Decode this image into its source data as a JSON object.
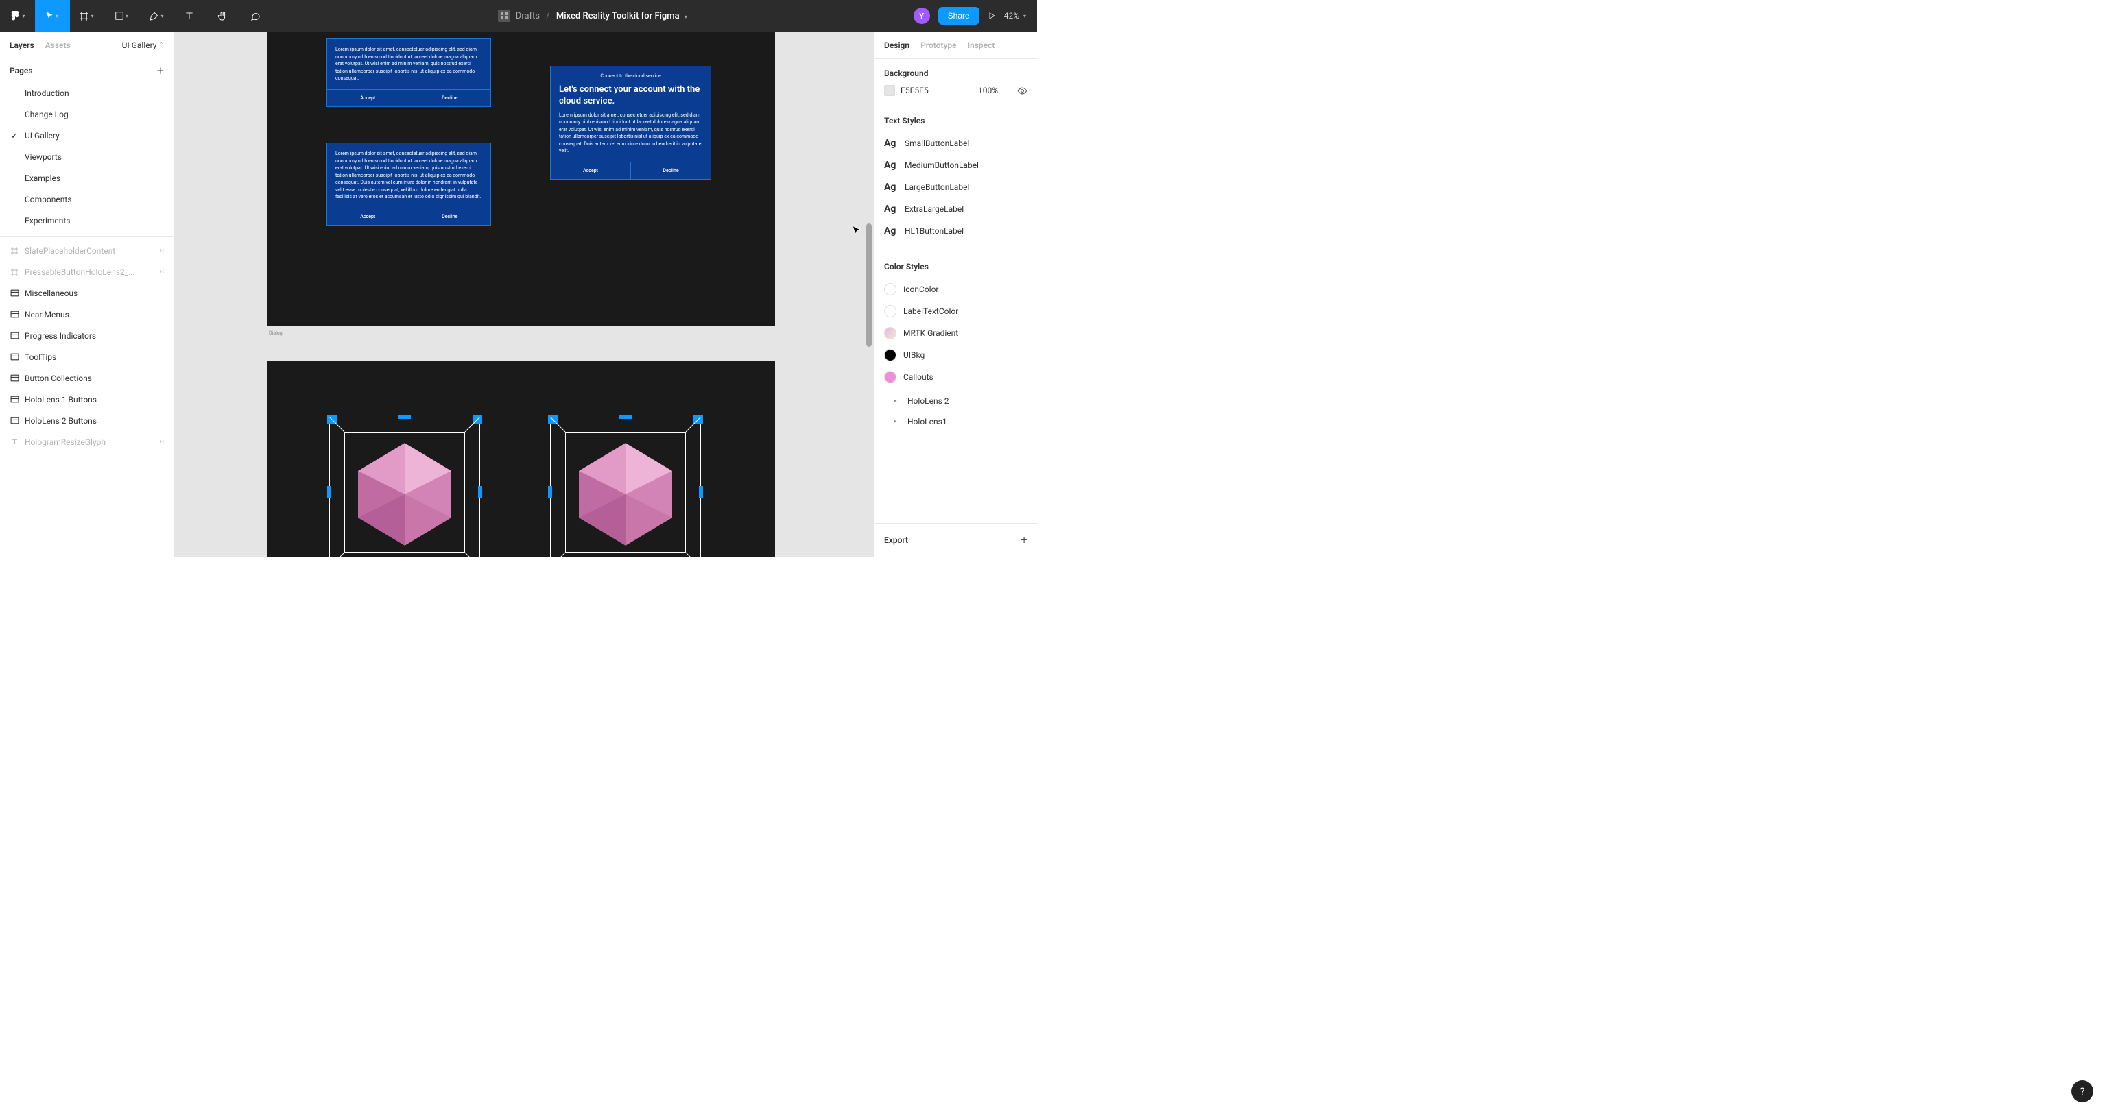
{
  "toolbar": {
    "project_folder": "Drafts",
    "document_title": "Mixed Reality Toolkit for Figma",
    "avatar_initial": "Y",
    "share_label": "Share",
    "zoom": "42%"
  },
  "left_panel": {
    "tabs": {
      "layers": "Layers",
      "assets": "Assets"
    },
    "page_selector": "UI Gallery",
    "pages_header": "Pages",
    "pages": [
      {
        "label": "Introduction",
        "selected": false
      },
      {
        "label": "Change Log",
        "selected": false
      },
      {
        "label": "UI Gallery",
        "selected": true
      },
      {
        "label": "Viewports",
        "selected": false
      },
      {
        "label": "Examples",
        "selected": false
      },
      {
        "label": "Components",
        "selected": false
      },
      {
        "label": "Experiments",
        "selected": false
      }
    ],
    "layers": [
      {
        "icon": "frame",
        "label": "SlatePlaceholderContent",
        "dim": true,
        "glyph": true
      },
      {
        "icon": "frame",
        "label": "PressableButtonHoloLens2_...",
        "dim": true,
        "glyph": true
      },
      {
        "icon": "section",
        "label": "Miscellaneous",
        "dim": false
      },
      {
        "icon": "section",
        "label": "Near Menus",
        "dim": false
      },
      {
        "icon": "section",
        "label": "Progress Indicators",
        "dim": false
      },
      {
        "icon": "section",
        "label": "ToolTips",
        "dim": false
      },
      {
        "icon": "section",
        "label": "Button Collections",
        "dim": false
      },
      {
        "icon": "section",
        "label": "HoloLens 1 Buttons",
        "dim": false
      },
      {
        "icon": "section",
        "label": "HoloLens 2 Buttons",
        "dim": false
      },
      {
        "icon": "text",
        "label": "HologramResizeGlyph",
        "dim": true,
        "glyph": true
      }
    ]
  },
  "canvas": {
    "frame1_label": "Dialog",
    "dialog_text_short": "Lorem ipsum dolor sit amet, consectetuer adipiscing elit, sed diam nonummy nibh euismod tincidunt ut laoreet dolore magna aliquam erat volutpat. Ut wisi enim ad minim veniam, quis nostrud exerci tation ullamcorper suscipit lobortis nisl ut aliquip ex ea commodo consequat.",
    "dialog_text_long": "Lorem ipsum dolor sit amet, consectetuer adipiscing elit, sed diam nonummy nibh euismod tincidunt ut laoreet dolore magna aliquam erat volutpat. Ut wisi enim ad minim veniam, quis nostrud exerci tation ullamcorper suscipit lobortis nisl ut aliquip ex ea commodo consequat. Duis autem vel eum iriure dolor in hendrerit in vulputate velit esse molestie consequat, vel illum dolore eu feugiat nulla facilisis at vero eros et accumsan et iusto odio dignissim qui blandit.",
    "dialog_text_mid": "Lorem ipsum dolor sit amet, consectetuer adipiscing elit, sed diam nonummy nibh euismod tincidunt ut laoreet dolore magna aliquam erat volutpat. Ut wisi enim ad minim veniam, quis nostrud exerci tation ullamcorper suscipit lobortis nisl ut aliquip ex ea commodo consequat. Duis autem vel eum iriure dolor in hendrerit in vulputate velit.",
    "cloud_title": "Connect to the cloud service",
    "cloud_heading": "Let's connect your account with the cloud service.",
    "accept": "Accept",
    "decline": "Decline"
  },
  "right_panel": {
    "tabs": {
      "design": "Design",
      "prototype": "Prototype",
      "inspect": "Inspect"
    },
    "background_title": "Background",
    "bg_hex": "E5E5E5",
    "bg_opacity": "100%",
    "text_styles_title": "Text Styles",
    "text_styles": [
      "SmallButtonLabel",
      "MediumButtonLabel",
      "LargeButtonLabel",
      "ExtraLargeLabel",
      "HL1ButtonLabel"
    ],
    "color_styles_title": "Color Styles",
    "color_styles": [
      {
        "label": "IconColor",
        "color": "#ffffff"
      },
      {
        "label": "LabelTextColor",
        "color": "#ffffff"
      },
      {
        "label": "MRTK Gradient",
        "color": "linear-gradient(135deg,#e6b8dd,#f0e8d8)"
      },
      {
        "label": "UIBkg",
        "color": "#000000"
      },
      {
        "label": "Callouts",
        "color": "#ef8fd8"
      }
    ],
    "color_groups": [
      "HoloLens 2",
      "HoloLens1"
    ],
    "export_label": "Export"
  }
}
